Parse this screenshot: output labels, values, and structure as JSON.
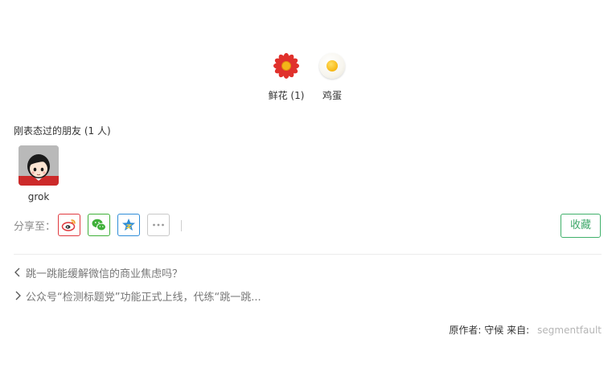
{
  "reactions": [
    {
      "name": "flower",
      "label": "鲜花 (1)",
      "icon": "flower-icon"
    },
    {
      "name": "egg",
      "label": "鸡蛋",
      "icon": "egg-icon"
    }
  ],
  "friends": {
    "title": "刚表态过的朋友 (1 人)",
    "users": [
      {
        "name": "grok",
        "icon": "avatar"
      }
    ]
  },
  "share": {
    "label": "分享至：",
    "targets": [
      {
        "name": "weibo",
        "icon": "weibo-icon",
        "color": "#e0393e"
      },
      {
        "name": "wechat",
        "icon": "wechat-icon",
        "color": "#3fb039"
      },
      {
        "name": "qzone",
        "icon": "qzone-icon",
        "color": "#2e8dd8"
      },
      {
        "name": "more",
        "icon": "more-icon",
        "color": "#999999"
      }
    ],
    "collect_label": "收藏"
  },
  "navigation": {
    "prev": {
      "text": "跳一跳能缓解微信的商业焦虑吗？",
      "icon": "chevron-left-icon"
    },
    "next": {
      "text": "公众号“检测标题党”功能正式上线，代练“跳一跳...",
      "icon": "chevron-right-icon"
    }
  },
  "source": {
    "author_label": "原作者: 守候 来自:",
    "source_name": "segmentfault"
  },
  "colors": {
    "accent": "#3fa86b",
    "flower": "#e0312c",
    "link_muted": "#b5b5b5"
  }
}
